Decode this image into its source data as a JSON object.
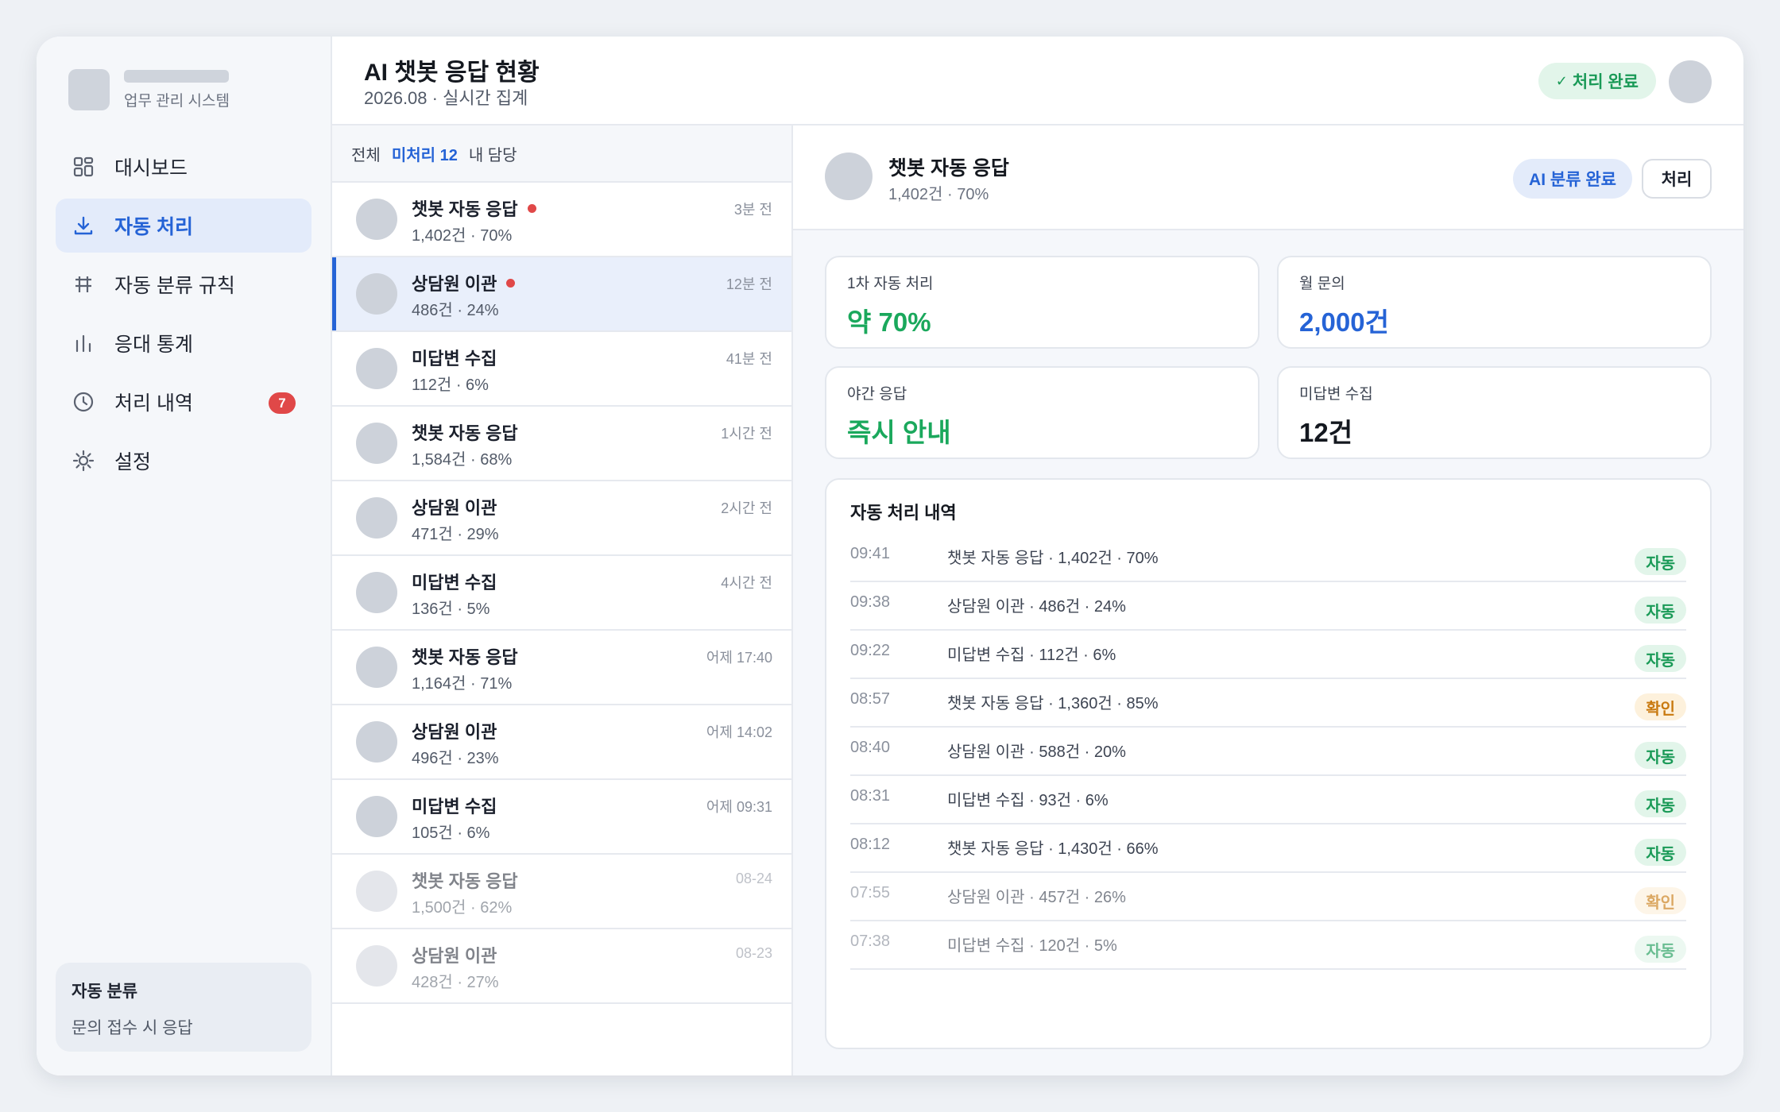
{
  "sidebar": {
    "brand_sub": "업무 관리 시스템",
    "items": [
      {
        "label": "대시보드",
        "icon": "grid-icon"
      },
      {
        "label": "자동 처리",
        "icon": "download-icon"
      },
      {
        "label": "자동 분류 규칙",
        "icon": "table-icon"
      },
      {
        "label": "응대 통계",
        "icon": "bar-chart-icon"
      },
      {
        "label": "처리 내역",
        "icon": "clock-icon",
        "badge": "7"
      },
      {
        "label": "설정",
        "icon": "gear-icon"
      }
    ],
    "card": {
      "title": "자동 분류",
      "sub": "문의 접수 시 응답"
    }
  },
  "header": {
    "title": "AI 챗봇 응답 현황",
    "subtitle": "2026.08 · 실시간 집계",
    "status": "처리 완료",
    "status_check": "✓"
  },
  "list": {
    "filters": [
      "전체",
      "미처리 12",
      "내 담당"
    ],
    "items": [
      {
        "title": "챗봇 자동 응답",
        "meta": "1,402건 · 70%",
        "time": "3분 전",
        "unread": true
      },
      {
        "title": "상담원 이관",
        "meta": "486건 · 24%",
        "time": "12분 전",
        "unread": true
      },
      {
        "title": "미답변 수집",
        "meta": "112건 · 6%",
        "time": "41분 전",
        "unread": false
      },
      {
        "title": "챗봇 자동 응답",
        "meta": "1,584건 · 68%",
        "time": "1시간 전",
        "unread": false
      },
      {
        "title": "상담원 이관",
        "meta": "471건 · 29%",
        "time": "2시간 전",
        "unread": false
      },
      {
        "title": "미답변 수집",
        "meta": "136건 · 5%",
        "time": "4시간 전",
        "unread": false
      },
      {
        "title": "챗봇 자동 응답",
        "meta": "1,164건 · 71%",
        "time": "어제 17:40",
        "unread": false
      },
      {
        "title": "상담원 이관",
        "meta": "496건 · 23%",
        "time": "어제 14:02",
        "unread": false
      },
      {
        "title": "미답변 수집",
        "meta": "105건 · 6%",
        "time": "어제 09:31",
        "unread": false
      },
      {
        "title": "챗봇 자동 응답",
        "meta": "1,500건 · 62%",
        "time": "08-24",
        "unread": false
      },
      {
        "title": "상담원 이관",
        "meta": "428건 · 27%",
        "time": "08-23",
        "unread": false
      }
    ]
  },
  "detail": {
    "title": "챗봇 자동 응답",
    "sub": "1,402건 · 70%",
    "ai_chip": "AI 분류 완료",
    "action": "처리",
    "stats": [
      {
        "label": "1차 자동 처리",
        "value": "약 70%",
        "color": "#1aa85c"
      },
      {
        "label": "월 문의",
        "value": "2,000건",
        "color": "#2563d6"
      },
      {
        "label": "야간 응답",
        "value": "즉시 안내",
        "color": "#1aa85c"
      },
      {
        "label": "미답변 수집",
        "value": "12건",
        "color": "#14181f"
      }
    ],
    "history_title": "자동 처리 내역",
    "history": [
      {
        "time": "09:41",
        "text": "챗봇 자동 응답 · 1,402건 · 70%",
        "tag": "자동"
      },
      {
        "time": "09:38",
        "text": "상담원 이관 · 486건 · 24%",
        "tag": "자동"
      },
      {
        "time": "09:22",
        "text": "미답변 수집 · 112건 · 6%",
        "tag": "자동"
      },
      {
        "time": "08:57",
        "text": "챗봇 자동 응답 · 1,360건 · 85%",
        "tag": "확인"
      },
      {
        "time": "08:40",
        "text": "상담원 이관 · 588건 · 20%",
        "tag": "자동"
      },
      {
        "time": "08:31",
        "text": "미답변 수집 · 93건 · 6%",
        "tag": "자동"
      },
      {
        "time": "08:12",
        "text": "챗봇 자동 응답 · 1,430건 · 66%",
        "tag": "자동"
      },
      {
        "time": "07:55",
        "text": "상담원 이관 · 457건 · 26%",
        "tag": "확인"
      },
      {
        "time": "07:38",
        "text": "미답변 수집 · 120건 · 5%",
        "tag": "자동"
      }
    ]
  },
  "colors": {
    "accent": "#2563d6",
    "success": "#1aa85c",
    "warning": "#c97a10",
    "danger": "#e04848"
  }
}
